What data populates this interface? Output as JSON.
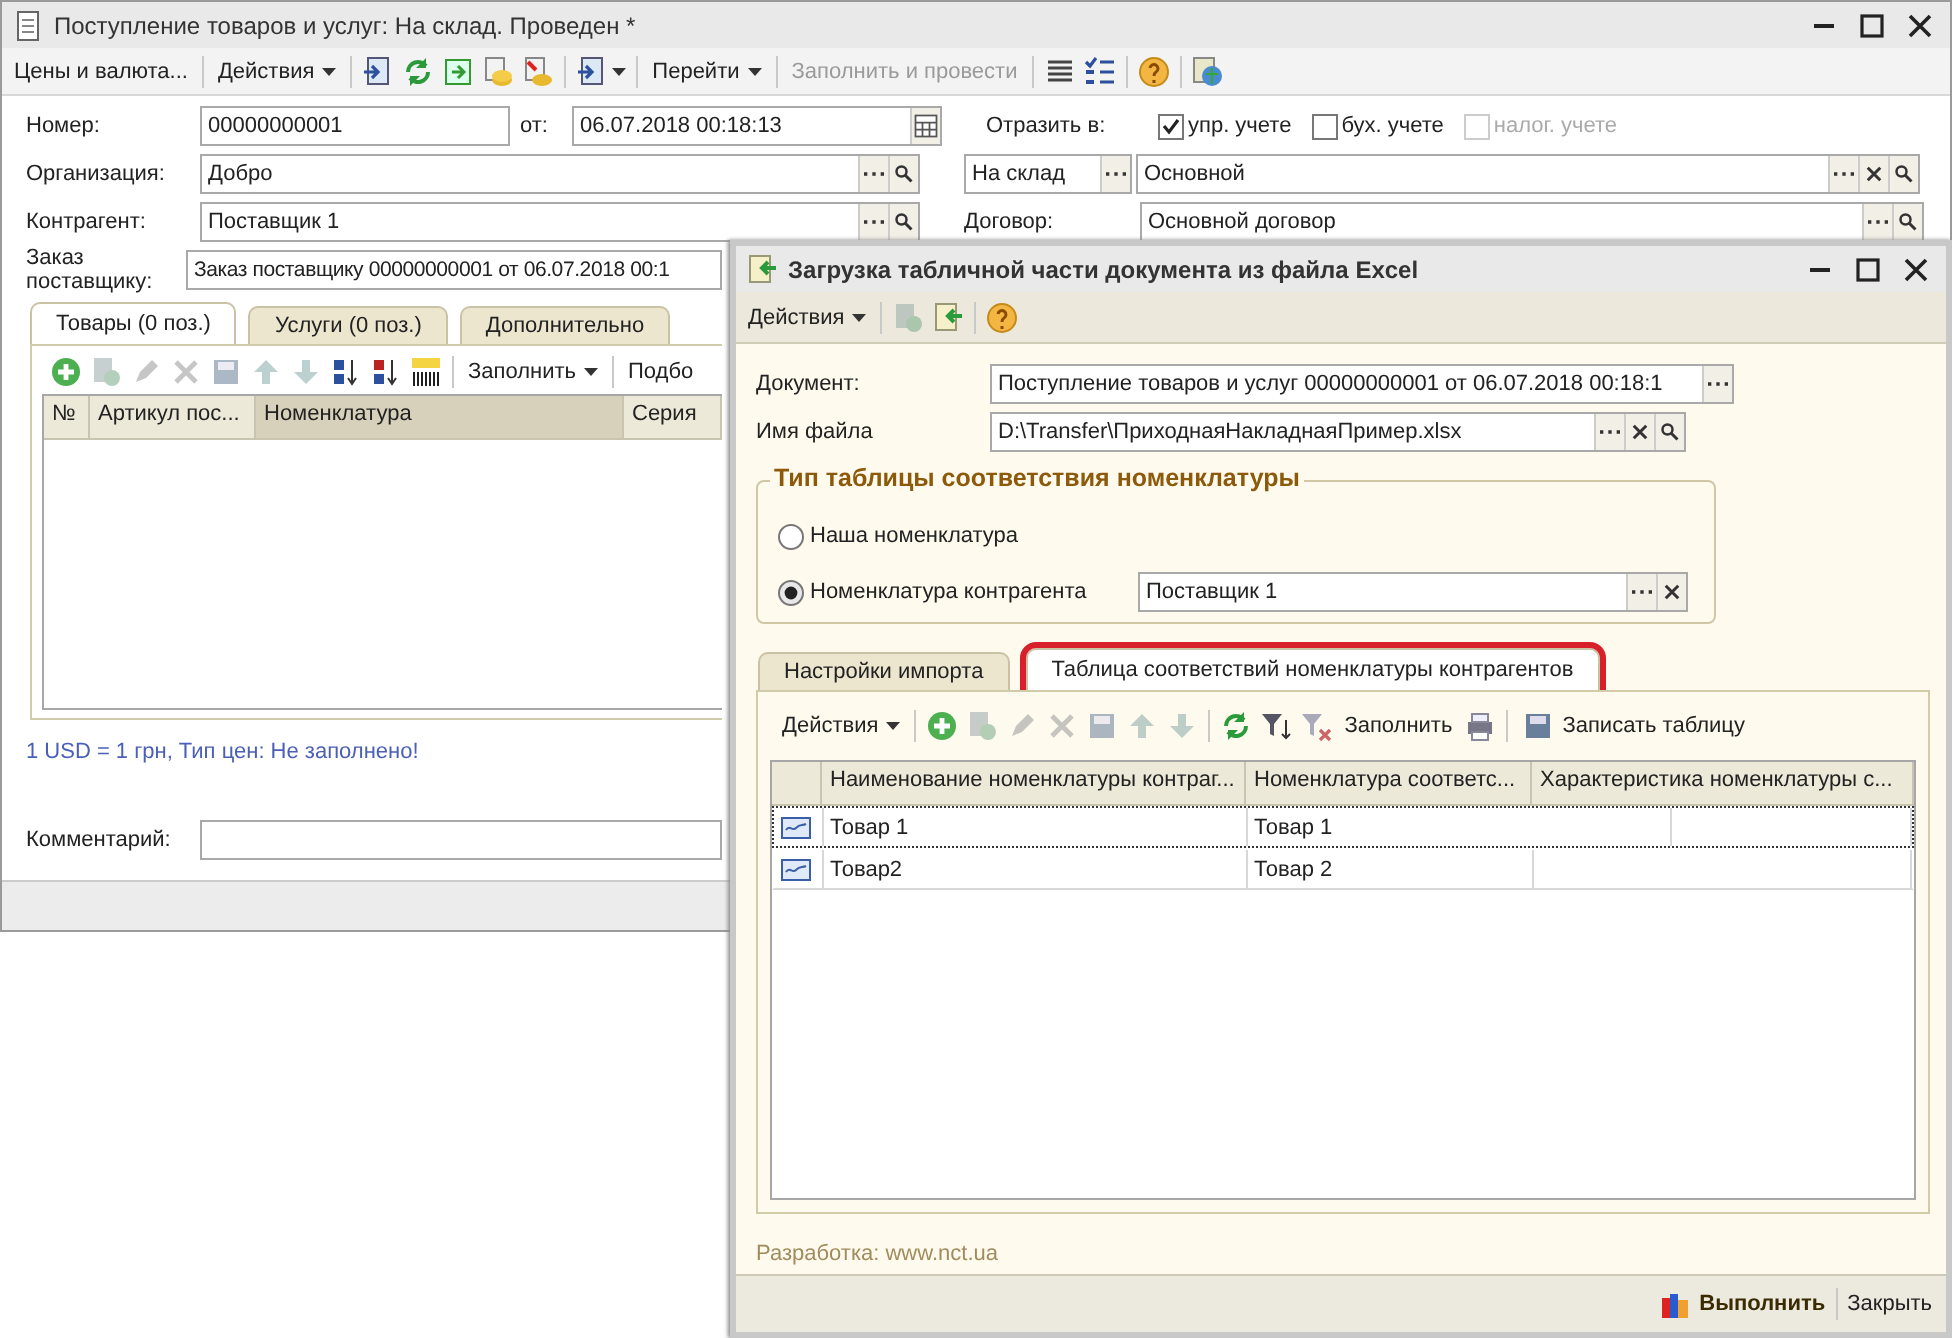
{
  "main_window": {
    "title": "Поступление товаров и услуг: На склад. Проведен *",
    "toolbar": [
      {
        "label": "Цены и валюта...",
        "kind": "button",
        "disabled": false
      },
      {
        "label": "Действия",
        "kind": "menu",
        "disabled": false
      },
      {
        "label": "Перейти",
        "kind": "menu",
        "disabled": false
      },
      {
        "label": "Заполнить и провести",
        "kind": "button",
        "disabled": true
      }
    ],
    "number": {
      "label": "Номер:",
      "value": "00000000001"
    },
    "date": {
      "label": "от:",
      "value": "06.07.2018 00:18:13"
    },
    "reflect": {
      "label": "Отразить в:",
      "options": [
        {
          "label": "упр. учете",
          "checked": true,
          "disabled": false
        },
        {
          "label": "бух. учете",
          "checked": false,
          "disabled": false
        },
        {
          "label": "налог. учете",
          "checked": false,
          "disabled": true
        }
      ]
    },
    "organization": {
      "label": "Организация:",
      "value": "Добро"
    },
    "warehouse_kind": {
      "value": "На склад"
    },
    "warehouse": {
      "value": "Основной"
    },
    "counterparty": {
      "label": "Контрагент:",
      "value": "Поставщик 1"
    },
    "contract": {
      "label": "Договор:",
      "value": "Основной договор"
    },
    "order": {
      "label": "Заказ поставщику:",
      "value": "Заказ поставщику 00000000001 от 06.07.2018 00:1"
    },
    "tabs": [
      {
        "label": "Товары (0 поз.)",
        "selected": true
      },
      {
        "label": "Услуги (0 поз.)",
        "selected": false
      },
      {
        "label": "Дополнительно",
        "selected": false
      }
    ],
    "tab_toolbar": [
      {
        "label": "Заполнить",
        "kind": "menu"
      },
      {
        "label": "Подбо",
        "kind": "button"
      }
    ],
    "table": {
      "columns": [
        {
          "label": "№",
          "selected": false
        },
        {
          "label": "Артикул пос...",
          "selected": false
        },
        {
          "label": "Номенклатура",
          "selected": true
        },
        {
          "label": "Серия",
          "selected": false
        }
      ]
    },
    "currency_note": "1 USD = 1 грн, Тип цен: Не заполнено!",
    "comment": {
      "label": "Комментарий:"
    }
  },
  "dialog": {
    "title": "Загрузка табличной части документа из файла Excel",
    "toolbar": [
      {
        "label": "Действия",
        "kind": "menu"
      }
    ],
    "document": {
      "label": "Документ:",
      "value": "Поступление товаров и услуг 00000000001 от 06.07.2018 00:18:1"
    },
    "file": {
      "label": "Имя файла",
      "value": "D:\\Transfer\\ПриходнаяНакладнаяПример.xlsx"
    },
    "group": {
      "title": "Тип таблицы соответствия номенклатуры",
      "options": [
        {
          "label": "Наша номенклатура",
          "selected": false
        },
        {
          "label": "Номенклатура контрагента",
          "selected": true,
          "value": "Поставщик 1"
        }
      ]
    },
    "tabs": [
      {
        "label": "Настройки импорта",
        "selected": false,
        "highlighted": false
      },
      {
        "label": "Таблица соответствий номенклатуры контрагентов",
        "selected": true,
        "highlighted": true
      }
    ],
    "tab_toolbar": [
      {
        "label": "Действия",
        "kind": "menu"
      },
      {
        "label": "Заполнить",
        "kind": "button"
      },
      {
        "label": "Записать таблицу",
        "kind": "save"
      }
    ],
    "table": {
      "columns": [
        "Наименование номенклатуры контраг...",
        "Номенклатура соответс...",
        "Характеристика номенклатуры с..."
      ],
      "rows": [
        {
          "cells": [
            "Товар 1",
            "Товар 1"
          ],
          "current": true
        },
        {
          "cells": [
            "Товар2",
            "Товар 2"
          ],
          "current": false
        }
      ]
    },
    "footer": "Разработка: www.nct.ua",
    "buttons": [
      {
        "label": "Выполнить",
        "default": true
      },
      {
        "label": "Закрыть",
        "default": false
      }
    ]
  }
}
